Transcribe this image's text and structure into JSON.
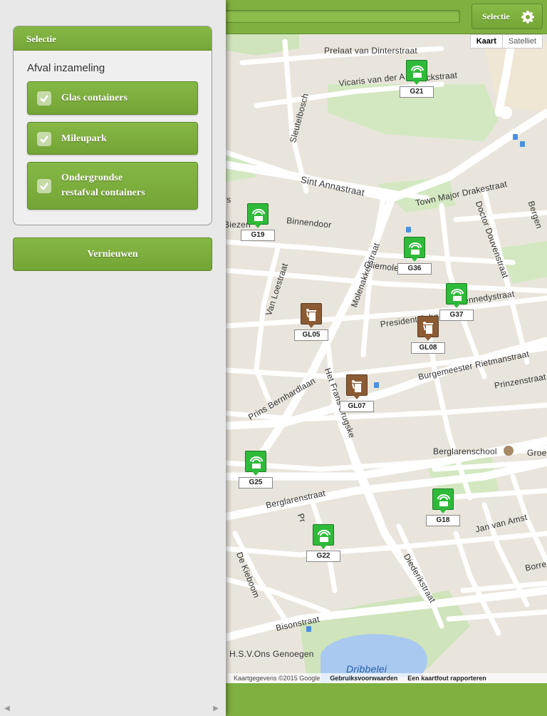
{
  "topbar": {
    "selectie_button": "Selectie"
  },
  "panel": {
    "box_title": "Selectie",
    "subtitle": "Afval inzameling",
    "options": [
      {
        "label_lines": [
          "Glas containers"
        ],
        "checked": true
      },
      {
        "label_lines": [
          "Mileupark"
        ],
        "checked": true
      },
      {
        "label_lines": [
          "Ondergrondse",
          "restafval containers"
        ],
        "checked": true
      }
    ],
    "refresh_button": "Vernieuwen"
  },
  "map": {
    "maptype": {
      "kaart": "Kaart",
      "satelliet": "Satelliet"
    },
    "attribution": {
      "copyright": "Kaartgegevens ©2015 Google",
      "terms": "Gebruiksvoorwaarden",
      "report": "Een kaartfout rapporteren"
    },
    "streets": [
      "Prelaat van Dinterstraat",
      "Vicaris van der A",
      "ckstraat",
      "Sleutelbosch",
      "Sint Annastraat",
      "Town Major Drakestraat",
      "Doctor Douvenstraat",
      "Bergen",
      "Binnendoor",
      "Biezen",
      "Molenakkerstraat",
      "Oliemolen",
      "Van Loestraat",
      "President John",
      "Kennedystraat",
      "Burgemeester Rietmanstraat",
      "Prinzenstraat",
      "Prins Bernhardlaan",
      "Het Frans Brugske",
      "Berglarenschool",
      "Groe",
      "Berglarenstraat",
      "Jan van Amst",
      "De Kieboom",
      "Diederikstraat",
      "Borre",
      "Bisonstraat",
      "H.S.V.Ons Genoegen",
      "Dribbelei",
      "rs",
      "Pr"
    ],
    "markers": [
      {
        "code": "G21",
        "kind": "glass"
      },
      {
        "code": "G19",
        "kind": "glass"
      },
      {
        "code": "G36",
        "kind": "glass"
      },
      {
        "code": "G37",
        "kind": "glass"
      },
      {
        "code": "GL05",
        "kind": "waste"
      },
      {
        "code": "GL08",
        "kind": "waste"
      },
      {
        "code": "GL07",
        "kind": "waste"
      },
      {
        "code": "G25",
        "kind": "glass"
      },
      {
        "code": "G18",
        "kind": "glass"
      },
      {
        "code": "G22",
        "kind": "glass"
      }
    ]
  },
  "colors": {
    "brand_green": "#7fb040",
    "glass_marker": "#2fba3a",
    "waste_marker": "#8b5b34"
  },
  "icons": {
    "settings": "gear-icon",
    "check": "checkmark-icon",
    "glass": "glass-container-icon",
    "waste": "trash-can-icon"
  }
}
